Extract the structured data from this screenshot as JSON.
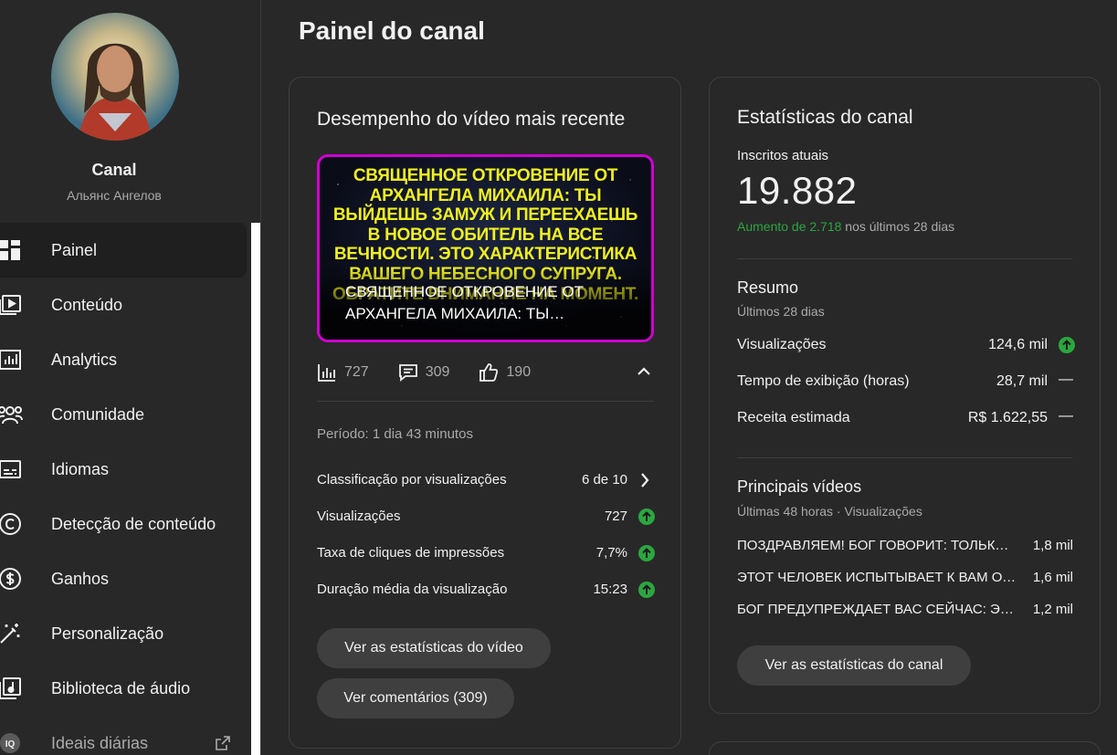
{
  "sidebar": {
    "channel_title": "Canal",
    "channel_name": "Альянс Ангелов",
    "items": [
      {
        "label": "Painel",
        "icon": "dashboard-icon"
      },
      {
        "label": "Conteúdo",
        "icon": "content-icon"
      },
      {
        "label": "Analytics",
        "icon": "analytics-icon"
      },
      {
        "label": "Comunidade",
        "icon": "community-icon"
      },
      {
        "label": "Idiomas",
        "icon": "subtitles-icon"
      },
      {
        "label": "Detecção de conteúdo",
        "icon": "copyright-icon"
      },
      {
        "label": "Ganhos",
        "icon": "dollar-icon"
      },
      {
        "label": "Personalização",
        "icon": "magic-wand-icon"
      },
      {
        "label": "Biblioteca de áudio",
        "icon": "audio-library-icon"
      },
      {
        "label": "Ideais diárias",
        "icon": "iq-icon"
      }
    ]
  },
  "page": {
    "title": "Painel do canal"
  },
  "latest_video": {
    "heading": "Desempenho do vídeo mais recente",
    "thumbnail_overlay": "СВЯЩЕННОЕ ОТКРОВЕНИЕ ОТ АРХАНГЕЛА МИХАИЛА: ТЫ ВЫЙДЕШЬ ЗАМУЖ И ПЕРЕЕХАЕШЬ В НОВОЕ ОБИТЕЛЬ НА ВСЕ ВЕЧНОСТИ. ЭТО ХАРАКТЕРИСТИКА ВАШЕГО НЕБЕСНОГО СУПРУГА. ОБРАТИТЕ ВНИМАНИЕ НА МОМЕНТ.",
    "title": "СВЯЩЕННОЕ ОТКРОВЕНИЕ ОТ АРХАНГЕЛА МИХАИЛА: ТЫ…",
    "views": "727",
    "comments": "309",
    "likes": "190",
    "period": "Período: 1 dia 43 minutos",
    "metrics": [
      {
        "label": "Classificação por visualizações",
        "value": "6 de 10"
      },
      {
        "label": "Visualizações",
        "value": "727"
      },
      {
        "label": "Taxa de cliques de impressões",
        "value": "7,7%"
      },
      {
        "label": "Duração média da visualização",
        "value": "15:23"
      }
    ],
    "btn_stats": "Ver as estatísticas do vídeo",
    "btn_comments": "Ver comentários (309)"
  },
  "channel_stats": {
    "heading": "Estatísticas do canal",
    "subs_label": "Inscritos atuais",
    "subs_value": "19.882",
    "growth_green": "Aumento de 2.718",
    "growth_rest": " nos últimos 28 dias",
    "summary_title": "Resumo",
    "summary_sub": "Últimos 28 dias",
    "summary": [
      {
        "label": "Visualizações",
        "value": "124,6 mil",
        "trend": "up"
      },
      {
        "label": "Tempo de exibição (horas)",
        "value": "28,7 mil",
        "trend": "—"
      },
      {
        "label": "Receita estimada",
        "value": "R$ 1.622,55",
        "trend": "—"
      }
    ],
    "top_title": "Principais vídeos",
    "top_sub": "Últimas 48 horas · Visualizações",
    "top_videos": [
      {
        "title": "ПОЗДРАВЛЯЕМ! БОГ ГОВОРИТ: ТОЛЬКО ТЫ ДОСТОИН ЭТОГО БЛАГОСЛОВЕНИЯ",
        "value": "1,8 mil"
      },
      {
        "title": "ЭТОТ ЧЕЛОВЕК ИСПЫТЫВАЕТ К ВАМ ОЧЕНЬ СИЛЬНЫЕ ЧУВСТВА",
        "value": "1,6 mil"
      },
      {
        "title": "БОГ ПРЕДУПРЕЖДАЕТ ВАС СЕЙЧАС: ЭТО ПОСЛЕДНЕЕ ПРЕДУПРЕЖДЕНИЕ",
        "value": "1,2 mil"
      }
    ],
    "btn_channel": "Ver as estatísticas do canal"
  },
  "colors": {
    "accent_green": "#2ba640",
    "thumbnail_border": "#d000d0",
    "thumbnail_text": "#f0f020"
  }
}
